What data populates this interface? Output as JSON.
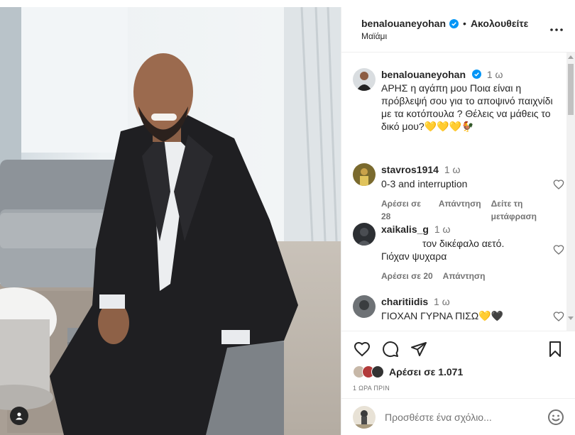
{
  "post": {
    "username": "benalouaneyohan",
    "follow_label": "Ακολουθείτε",
    "dot": "•",
    "location": "Μαϊάμι",
    "caption_time": "1 ω",
    "caption": "ΑΡΗΣ η αγάπη μου Ποια είναι η πρόβλεψή σου για το αποψινό παιχνίδι με τα κοτόπουλα ? Θέλεις να μάθεις το δικό μου?💛💛💛🐓"
  },
  "comments": [
    {
      "user": "stavros1914",
      "time": "1 ω",
      "text": "0-3 and interruption",
      "likes": "Αρέσει σε 28",
      "reply": "Απάντηση",
      "translate": "Δείτε τη μετάφραση"
    },
    {
      "user": "xaikalis_g",
      "time": "1 ω",
      "text_line1": "τον δικέφαλο αετό.",
      "text_line2": "Γιόχαν ψυχαρα",
      "likes": "Αρέσει σε 20",
      "reply": "Απάντηση"
    },
    {
      "user": "charitiidis",
      "time": "1 ω",
      "text": "ΓΙΟΧΑΝ ΓΥΡΝΑ ΠΙΣΩ💛🖤"
    }
  ],
  "actions": {
    "likes_text": "Αρέσει σε 1.071",
    "time_ago": "1 ΩΡΑ ΠΡΙΝ"
  },
  "add_comment": {
    "placeholder": "Προσθέστε ένα σχόλιο..."
  },
  "icons": {
    "verified": "verified-badge-icon",
    "more": "more-options-icon",
    "like": "heart-icon",
    "comment": "comment-icon",
    "share": "share-icon",
    "save": "bookmark-icon",
    "emoji": "emoji-icon",
    "person": "person-tag-icon"
  },
  "colors": {
    "verified": "#0095f6",
    "muted": "#737373",
    "text": "#262626"
  }
}
